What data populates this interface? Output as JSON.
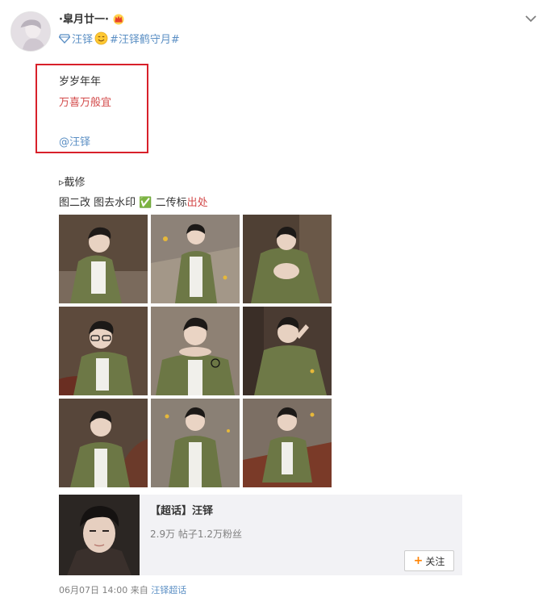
{
  "post": {
    "username": "·皐月廿一·",
    "tags": {
      "person_tag": "汪铎",
      "topic_tag": "#汪铎鹤守月#"
    },
    "highlight_lines": {
      "line1": "岁岁年年",
      "line2": "万喜万般宜",
      "mention": "@汪铎"
    },
    "body_lines": {
      "line4": "▹截修",
      "line5_text": "图二改 图去水印 ✅ 二传标",
      "line5_link": "出处"
    },
    "photos": [
      {
        "name": "photo-1"
      },
      {
        "name": "photo-2"
      },
      {
        "name": "photo-3"
      },
      {
        "name": "photo-4"
      },
      {
        "name": "photo-5"
      },
      {
        "name": "photo-6"
      },
      {
        "name": "photo-7"
      },
      {
        "name": "photo-8"
      },
      {
        "name": "photo-9"
      }
    ],
    "card": {
      "title": "【超话】汪铎",
      "stats": "2.9万 帖子1.2万粉丝",
      "follow_label": "关注"
    },
    "footer": {
      "date": "06月07日 14:00",
      "from_label": "来自",
      "source": "汪铎超话"
    }
  },
  "colors": {
    "link": "#5b8fc4",
    "accent_red": "#d34a4a",
    "box_red": "#d8202a",
    "follow_plus": "#ff8200"
  },
  "icons": {
    "verified": "diamond-icon",
    "crown": "crown-icon",
    "emoji": "smile-icon",
    "chevron": "chevron-down-icon"
  }
}
